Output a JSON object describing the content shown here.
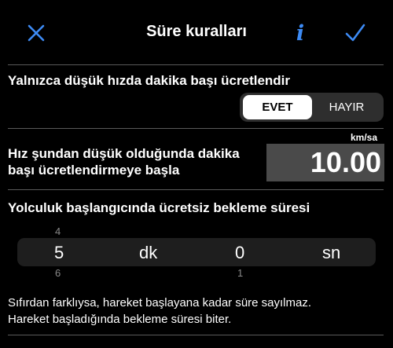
{
  "header": {
    "title": "Süre kuralları",
    "close_icon": "close-icon",
    "info_icon": "info-icon",
    "info_glyph": "i",
    "confirm_icon": "checkmark-icon",
    "accent_color": "#3d8bf5"
  },
  "low_speed_billing": {
    "label": "Yalnızca düşük hızda dakika başı ücretlendir",
    "options": [
      "EVET",
      "HAYIR"
    ],
    "selected": "EVET"
  },
  "speed_threshold": {
    "label_line1": "Hız şundan düşük olduğunda dakika",
    "label_line2": "başı ücretlendirmeye başla",
    "unit": "km/sa",
    "value": "10.00"
  },
  "free_wait": {
    "label": "Yolculuk başlangıcında ücretsiz bekleme süresi",
    "minutes_above": "4",
    "minutes": "5",
    "minutes_below": "6",
    "minutes_unit": "dk",
    "seconds_below": "1",
    "seconds": "0",
    "seconds_unit": "sn"
  },
  "note": {
    "line1": "Sıfırdan farklıysa, hareket başlayana kadar süre sayılmaz.",
    "line2": "Hareket başladığında bekleme süresi biter."
  }
}
